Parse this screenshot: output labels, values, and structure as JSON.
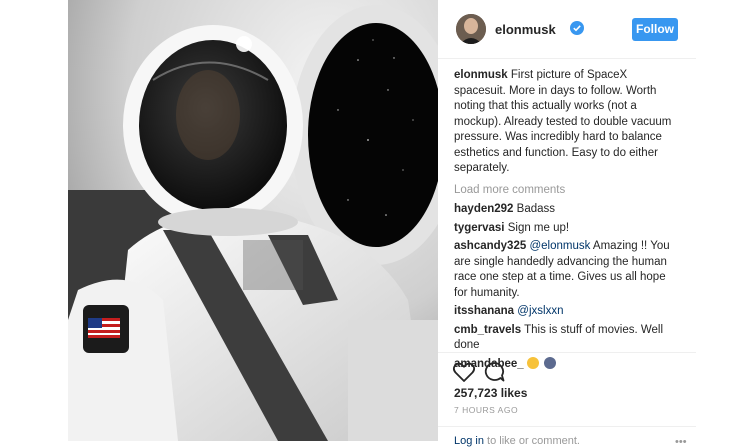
{
  "post": {
    "username": "elonmusk",
    "follow_label": "Follow",
    "caption_user": "elonmusk",
    "caption_text": "First picture of SpaceX spacesuit. More in days to follow. Worth noting that this actually works (not a mockup). Already tested to double vacuum pressure. Was incredibly hard to balance esthetics and function. Easy to do either separately.",
    "load_more": "Load more comments",
    "comments": [
      {
        "user": "hayden292",
        "text": "Badass"
      },
      {
        "user": "tygervasi",
        "text": "Sign me up!"
      },
      {
        "user": "ashcandy325",
        "mention": "@elonmusk",
        "text": "Amazing !! You are single handedly advancing the human race one step at a time. Gives us all hope for humanity."
      },
      {
        "user": "itsshanana",
        "mention": "@jxslxxn",
        "text": ""
      },
      {
        "user": "cmb_travels",
        "text": "This is stuff of movies. Well done"
      },
      {
        "user": "amandabee_",
        "text": ""
      }
    ],
    "likes": "257,723 likes",
    "timestamp": "7 HOURS AGO",
    "login_prefix": "Log in",
    "login_suffix": "to like or comment."
  },
  "icons": {
    "verified": "verified-badge-icon",
    "like": "heart-icon",
    "comment": "comment-bubble-icon",
    "more": "more-options-icon"
  },
  "colors": {
    "follow_button": "#3897f0",
    "verified_badge": "#3897f0",
    "mention": "#003569",
    "muted": "#999999"
  }
}
